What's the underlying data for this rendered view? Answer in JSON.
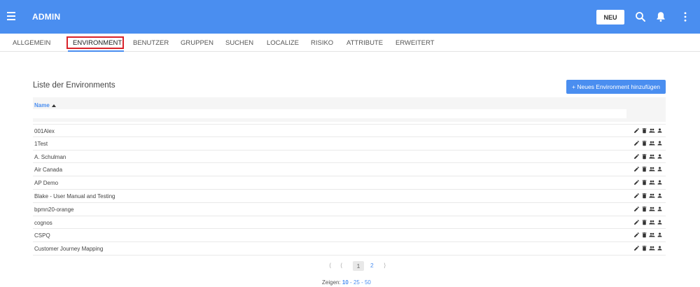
{
  "topbar": {
    "title": "ADMIN",
    "new_label": "NEU",
    "icons": [
      "menu-icon",
      "search-icon",
      "bell-icon",
      "more-vertical-icon"
    ]
  },
  "tabs": [
    {
      "label": "ALLGEMEIN"
    },
    {
      "label": "ENVIRONMENT"
    },
    {
      "label": "BENUTZER"
    },
    {
      "label": "GRUPPEN"
    },
    {
      "label": "SUCHEN"
    },
    {
      "label": "LOCALIZE"
    },
    {
      "label": "RISIKO"
    },
    {
      "label": "ATTRIBUTE"
    },
    {
      "label": "ERWEITERT"
    }
  ],
  "list": {
    "title": "Liste der Environments",
    "add_button": "+ Neues Environment hinzufügen",
    "column_name": "Name",
    "rows": [
      {
        "name": "001Alex"
      },
      {
        "name": "1Test"
      },
      {
        "name": "A. Schulman"
      },
      {
        "name": "Air Canada"
      },
      {
        "name": "AP Demo"
      },
      {
        "name": "Blake - User Manual and Testing"
      },
      {
        "name": "bpmn20-orange"
      },
      {
        "name": "cognos"
      },
      {
        "name": "CSPQ"
      },
      {
        "name": "Customer Journey Mapping"
      }
    ],
    "row_action_icons": [
      "edit-icon",
      "delete-icon",
      "group-icon",
      "user-icon"
    ]
  },
  "pagination": {
    "first": "⟨",
    "prev": "⟨",
    "current": "1",
    "page2": "2",
    "next": "⟩",
    "show_label": "Zeigen:",
    "show_options": [
      "10",
      "25",
      "50"
    ],
    "show_selected": "10"
  },
  "colors": {
    "accent": "#4a8ef0",
    "highlight": "#d9232a"
  }
}
